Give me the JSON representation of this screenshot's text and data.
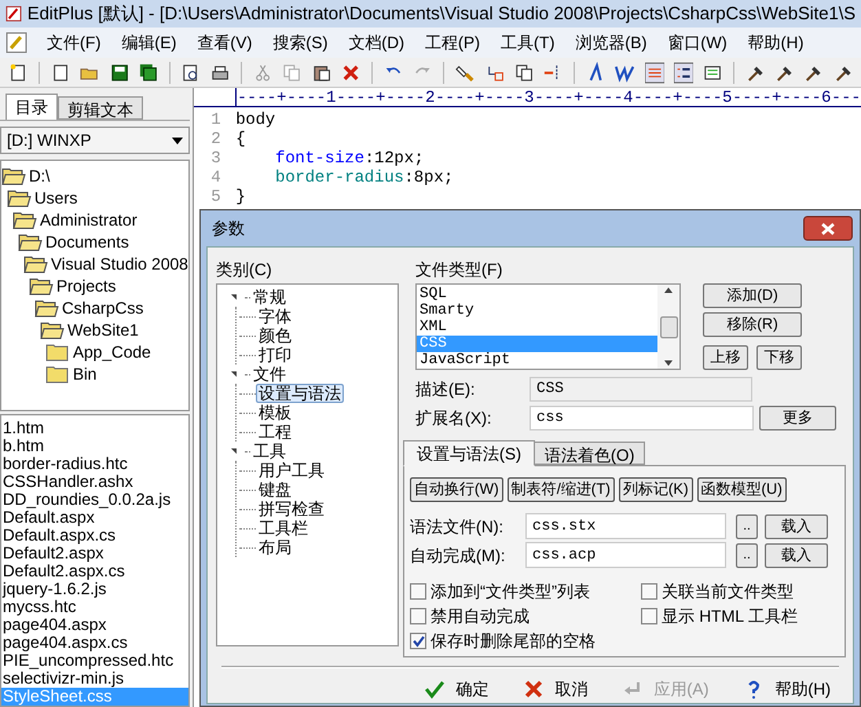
{
  "window": {
    "title": "EditPlus [默认] - [D:\\Users\\Administrator\\Documents\\Visual Studio 2008\\Projects\\CsharpCss\\WebSite1\\S"
  },
  "menu": [
    "文件(F)",
    "编辑(E)",
    "查看(V)",
    "搜索(S)",
    "文档(D)",
    "工程(P)",
    "工具(T)",
    "浏览器(B)",
    "窗口(W)",
    "帮助(H)"
  ],
  "sidebar": {
    "tabs": [
      {
        "label": "目录",
        "selected": true
      },
      {
        "label": "剪辑文本",
        "selected": false
      }
    ],
    "drive": "[D:] WINXP",
    "folders": [
      {
        "name": "D:\\",
        "expanded": true,
        "children": [
          {
            "name": "Users",
            "expanded": true,
            "children": [
              {
                "name": "Administrator",
                "expanded": true,
                "children": [
                  {
                    "name": "Documents",
                    "expanded": true,
                    "children": [
                      {
                        "name": "Visual Studio 2008",
                        "expanded": true,
                        "children": [
                          {
                            "name": "Projects",
                            "expanded": true,
                            "children": [
                              {
                                "name": "CsharpCss",
                                "expanded": true,
                                "children": [
                                  {
                                    "name": "WebSite1",
                                    "expanded": true,
                                    "children": [
                                      {
                                        "name": "App_Code",
                                        "expanded": false
                                      },
                                      {
                                        "name": "Bin",
                                        "expanded": false
                                      }
                                    ]
                                  }
                                ]
                              }
                            ]
                          }
                        ]
                      }
                    ]
                  }
                ]
              }
            ]
          }
        ]
      }
    ],
    "files": [
      {
        "name": "1.htm",
        "selected": false
      },
      {
        "name": "b.htm",
        "selected": false
      },
      {
        "name": "border-radius.htc",
        "selected": false
      },
      {
        "name": "CSSHandler.ashx",
        "selected": false
      },
      {
        "name": "DD_roundies_0.0.2a.js",
        "selected": false
      },
      {
        "name": "Default.aspx",
        "selected": false
      },
      {
        "name": "Default.aspx.cs",
        "selected": false
      },
      {
        "name": "Default2.aspx",
        "selected": false
      },
      {
        "name": "Default2.aspx.cs",
        "selected": false
      },
      {
        "name": "jquery-1.6.2.js",
        "selected": false
      },
      {
        "name": "mycss.htc",
        "selected": false
      },
      {
        "name": "page404.aspx",
        "selected": false
      },
      {
        "name": "page404.aspx.cs",
        "selected": false
      },
      {
        "name": "PIE_uncompressed.htc",
        "selected": false
      },
      {
        "name": "selectivizr-min.js",
        "selected": false
      },
      {
        "name": "StyleSheet.css",
        "selected": true
      }
    ]
  },
  "editor": {
    "ruler": "----+----1----+----2----+----3----+----4----+----5----+----6---",
    "lines": [
      {
        "number": "1",
        "segments": [
          {
            "text": "body",
            "color": "#000000"
          }
        ]
      },
      {
        "number": "2",
        "segments": [
          {
            "text": "{",
            "color": "#000000"
          }
        ]
      },
      {
        "number": "3",
        "segments": [
          {
            "text": "    font-size",
            "color": "#0000ff"
          },
          {
            "text": ":12px;",
            "color": "#000000"
          }
        ]
      },
      {
        "number": "4",
        "segments": [
          {
            "text": "    border-radius",
            "color": "#008080"
          },
          {
            "text": ":8px;",
            "color": "#000000"
          }
        ]
      },
      {
        "number": "5",
        "segments": [
          {
            "text": "}",
            "color": "#000000"
          }
        ]
      }
    ]
  },
  "dialog": {
    "title": "参数",
    "category_label": "类别(C)",
    "categories": [
      {
        "label": "常规",
        "expanded": true,
        "selected": false,
        "children": [
          {
            "label": "字体",
            "selected": false
          },
          {
            "label": "颜色",
            "selected": false
          },
          {
            "label": "打印",
            "selected": false
          }
        ]
      },
      {
        "label": "文件",
        "expanded": true,
        "selected": false,
        "children": [
          {
            "label": "设置与语法",
            "selected": true
          },
          {
            "label": "模板",
            "selected": false
          },
          {
            "label": "工程",
            "selected": false
          }
        ]
      },
      {
        "label": "工具",
        "expanded": true,
        "selected": false,
        "children": [
          {
            "label": "用户工具",
            "selected": false
          },
          {
            "label": "键盘",
            "selected": false
          },
          {
            "label": "拼写检查",
            "selected": false
          },
          {
            "label": "工具栏",
            "selected": false
          },
          {
            "label": "布局",
            "selected": false
          }
        ]
      }
    ],
    "filetype_label": "文件类型(F)",
    "filetypes": [
      {
        "label": "SQL",
        "selected": false
      },
      {
        "label": "Smarty",
        "selected": false
      },
      {
        "label": "XML",
        "selected": false
      },
      {
        "label": "CSS",
        "selected": true
      },
      {
        "label": "JavaScript",
        "selected": false
      }
    ],
    "add_button": "添加(D)",
    "remove_button": "移除(R)",
    "up_button": "上移",
    "down_button": "下移",
    "description": {
      "label": "描述(E):",
      "value": "CSS"
    },
    "extension": {
      "label": "扩展名(X):",
      "value": "css"
    },
    "more_button": "更多",
    "tabs": [
      {
        "label": "设置与语法(S)",
        "selected": true
      },
      {
        "label": "语法着色(O)",
        "selected": false
      }
    ],
    "tab_buttons": [
      "自动换行(W)",
      "制表符/缩进(T)",
      "列标记(K)",
      "函数模型(U)"
    ],
    "syntax_file": {
      "label": "语法文件(N):",
      "value": "css.stx",
      "browse": "..",
      "load": "载入"
    },
    "autocomplete": {
      "label": "自动完成(M):",
      "value": "css.acp",
      "browse": "..",
      "load": "载入"
    },
    "checkboxes": [
      {
        "label": "添加到“文件类型”列表",
        "checked": false
      },
      {
        "label": "关联当前文件类型",
        "checked": false
      },
      {
        "label": "禁用自动完成",
        "checked": false
      },
      {
        "label": "显示 HTML 工具栏",
        "checked": false
      },
      {
        "label": "保存时删除尾部的空格",
        "checked": true
      }
    ],
    "footer_buttons": [
      {
        "label": "确定",
        "kind": "ok",
        "disabled": false
      },
      {
        "label": "取消",
        "kind": "cancel",
        "disabled": false
      },
      {
        "label": "应用(A)",
        "kind": "apply",
        "disabled": true
      },
      {
        "label": "帮助(H)",
        "kind": "help",
        "disabled": false
      }
    ]
  }
}
